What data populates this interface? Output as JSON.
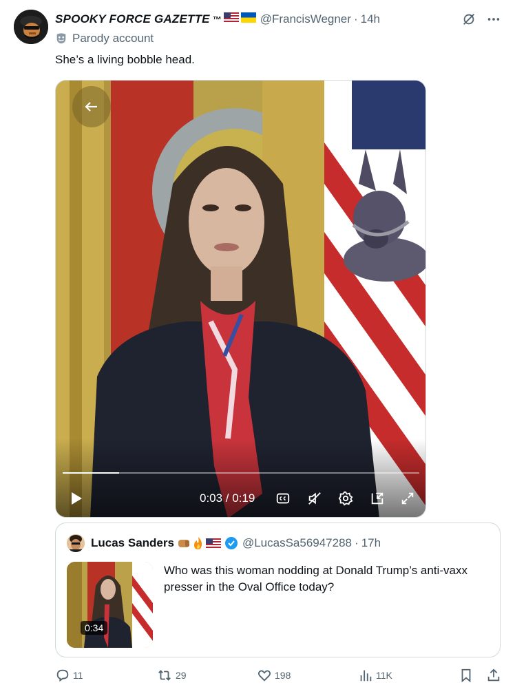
{
  "post": {
    "display_name": "SPOOKY FORCE GAZETTE",
    "tm": "™",
    "handle": "@FrancisWegner",
    "separator": "·",
    "time": "14h",
    "parody_label": "Parody account",
    "text": "She’s a living bobble head."
  },
  "video": {
    "current_time": "0:03",
    "duration": "0:19",
    "time_readout": "0:03 / 0:19",
    "progress_fraction": 0.158,
    "icons": [
      "back-arrow-icon",
      "play-icon",
      "closed-captions-icon",
      "muted-speaker-icon",
      "settings-gear-icon",
      "picture-in-picture-icon",
      "fullscreen-icon"
    ]
  },
  "quote": {
    "name": "Lucas Sanders",
    "handle": "@LucasSa56947288",
    "separator": "·",
    "time": "17h",
    "thumb_duration": "0:34",
    "text": "Who was this woman nodding at Donald Trump’s anti-vaxx presser in the Oval Office today?"
  },
  "actions": {
    "replies": "11",
    "reposts": "29",
    "likes": "198",
    "views": "11K"
  },
  "colors": {
    "text_primary": "#0f1419",
    "text_secondary": "#536471",
    "border": "#cfd9de",
    "verified": "#1d9bf0"
  }
}
